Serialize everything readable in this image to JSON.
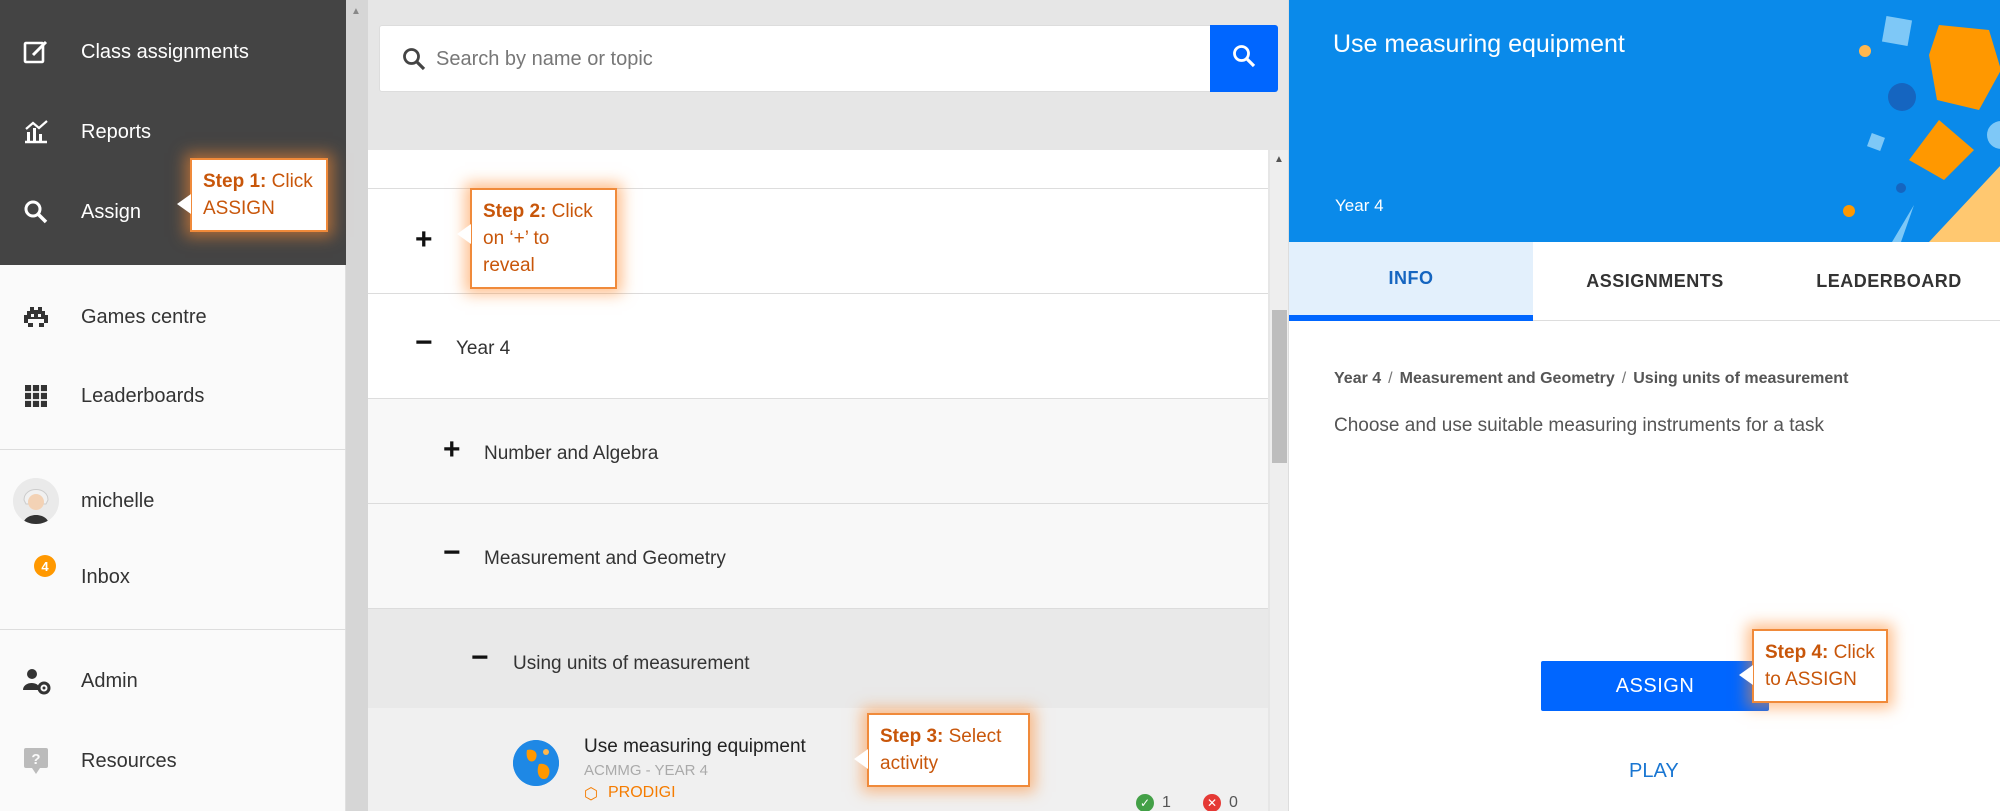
{
  "sidebar": {
    "items": [
      {
        "label": "Class assignments",
        "icon": "edit-square-icon"
      },
      {
        "label": "Reports",
        "icon": "bar-chart-icon"
      },
      {
        "label": "Assign",
        "icon": "search-icon"
      },
      {
        "label": "Games centre",
        "icon": "space-invader-icon"
      },
      {
        "label": "Leaderboards",
        "icon": "grid-icon"
      },
      {
        "label": "michelle",
        "icon": "avatar"
      },
      {
        "label": "Inbox",
        "badge": "4"
      },
      {
        "label": "Admin",
        "icon": "user-gear-icon"
      },
      {
        "label": "Resources",
        "icon": "help-icon"
      }
    ]
  },
  "search": {
    "placeholder": "Search by name or topic"
  },
  "tree": {
    "year4": "Year 4",
    "number_algebra": "Number and Algebra",
    "measurement_geometry": "Measurement and Geometry",
    "units": "Using units of measurement",
    "toggle_plus": "+",
    "toggle_minus": "−"
  },
  "activity": {
    "title": "Use measuring equipment",
    "subtitle": "ACMMG - YEAR 4",
    "source": "PRODIGI",
    "correct_count": "1",
    "wrong_count": "0"
  },
  "detail": {
    "title": "Use measuring equipment",
    "year": "Year 4",
    "tabs": [
      "INFO",
      "ASSIGNMENTS",
      "LEADERBOARD"
    ],
    "breadcrumb": [
      "Year 4",
      "Measurement and Geometry",
      "Using units of measurement"
    ],
    "breadcrumb_sep": "/",
    "description": "Choose and use suitable measuring instruments for a task",
    "assign_label": "ASSIGN",
    "play_label": "PLAY"
  },
  "callouts": {
    "step1": {
      "bold": "Step 1:",
      "text1": " Click",
      "text2": "ASSIGN"
    },
    "step2": {
      "bold": "Step 2:",
      "text1": " Click",
      "text2": "on ‘+’ to reveal"
    },
    "step3": {
      "bold": "Step 3:",
      "text1": " Select",
      "text2": "activity"
    },
    "step4": {
      "bold": "Step 4:",
      "text1": " Click",
      "text2": "to ASSIGN"
    }
  },
  "colors": {
    "primary": "#0066ff",
    "hero": "#0a8aea",
    "accent_orange": "#f08a3a",
    "sidebar_dark": "#444444"
  }
}
